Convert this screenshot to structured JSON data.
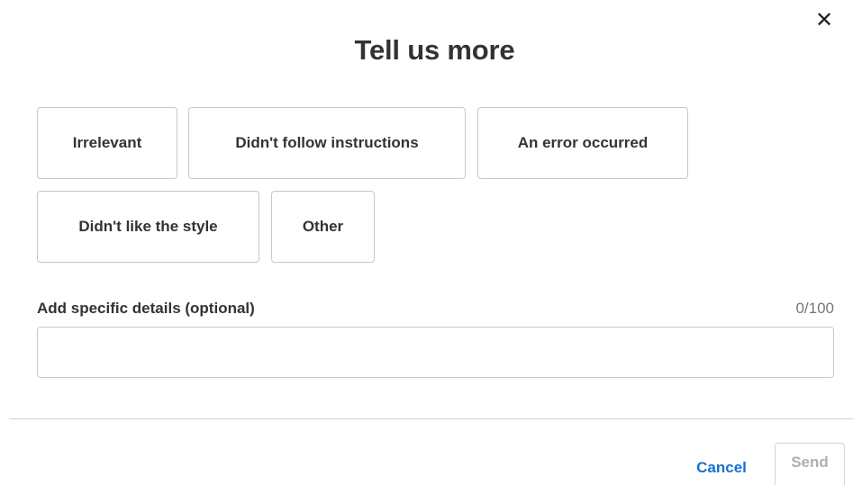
{
  "dialog": {
    "title": "Tell us more",
    "close_icon": "close-icon",
    "close_glyph": "✕"
  },
  "reasons": [
    {
      "label": "Irrelevant"
    },
    {
      "label": "Didn't follow instructions"
    },
    {
      "label": "An error occurred"
    },
    {
      "label": "Didn't like the style"
    },
    {
      "label": "Other"
    }
  ],
  "details": {
    "label": "Add specific details (optional)",
    "counter": "0/100",
    "value": "",
    "placeholder": ""
  },
  "footer": {
    "cancel_label": "Cancel",
    "send_label": "Send"
  },
  "colors": {
    "accent": "#1a6fd1",
    "disabled_text": "#b0b0b0",
    "border": "#c8c8c8"
  }
}
